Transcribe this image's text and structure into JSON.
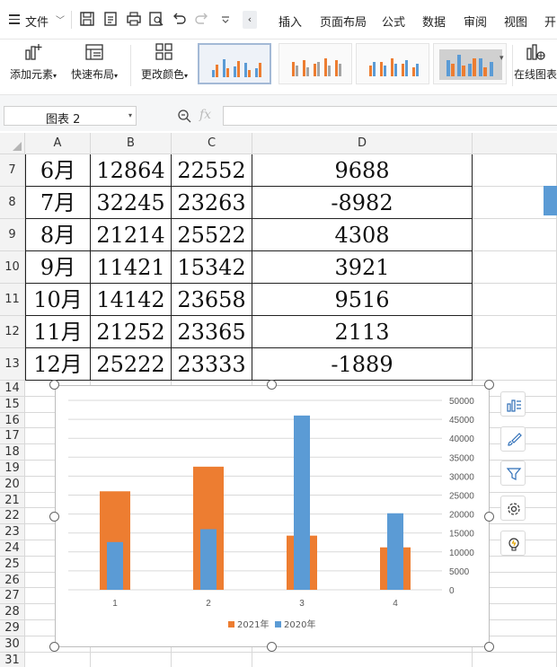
{
  "menubar": {
    "file_label": "文件",
    "tabs": [
      "插入",
      "页面布局",
      "公式",
      "数据",
      "审阅",
      "视图",
      "开"
    ]
  },
  "ribbon": {
    "add_element": "添加元素",
    "quick_layout": "快速布局",
    "change_color": "更改颜色",
    "online_chart": "在线图表"
  },
  "formula_bar": {
    "name_box": "图表 2",
    "fx_label": "fx",
    "formula": ""
  },
  "grid": {
    "columns": [
      "A",
      "B",
      "C",
      "D"
    ],
    "row_numbers": [
      "7",
      "8",
      "9",
      "10",
      "11",
      "12",
      "13",
      "14",
      "15",
      "16",
      "17",
      "18",
      "19",
      "20",
      "21",
      "22",
      "23",
      "24",
      "25",
      "26",
      "27",
      "28",
      "29",
      "30",
      "31"
    ],
    "rows": [
      {
        "a": "6月",
        "b": "12864",
        "c": "22552",
        "d": "9688"
      },
      {
        "a": "7月",
        "b": "32245",
        "c": "23263",
        "d": "-8982"
      },
      {
        "a": "8月",
        "b": "21214",
        "c": "25522",
        "d": "4308"
      },
      {
        "a": "9月",
        "b": "11421",
        "c": "15342",
        "d": "3921"
      },
      {
        "a": "10月",
        "b": "14142",
        "c": "23658",
        "d": "9516"
      },
      {
        "a": "11月",
        "b": "21252",
        "c": "23365",
        "d": "2113"
      },
      {
        "a": "12月",
        "b": "25222",
        "c": "23333",
        "d": "-1889"
      }
    ]
  },
  "chart_data": {
    "type": "bar",
    "categories": [
      "1",
      "2",
      "3",
      "4"
    ],
    "series": [
      {
        "name": "2021年",
        "values": [
          26000,
          32500,
          14300,
          11200
        ],
        "color": "#ed7d31"
      },
      {
        "name": "2020年",
        "values": [
          12600,
          16000,
          46000,
          20200
        ],
        "color": "#5b9bd5"
      }
    ],
    "ylim": [
      0,
      50000
    ],
    "yticks": [
      "0",
      "5000",
      "10000",
      "15000",
      "20000",
      "25000",
      "30000",
      "35000",
      "40000",
      "45000",
      "50000"
    ],
    "y_axis_side": "right",
    "grid": true,
    "legend": "bottom"
  },
  "chart_tools": [
    "chart-elements-icon",
    "chart-style-icon",
    "chart-filter-icon",
    "chart-settings-icon",
    "chart-ideas-icon"
  ]
}
